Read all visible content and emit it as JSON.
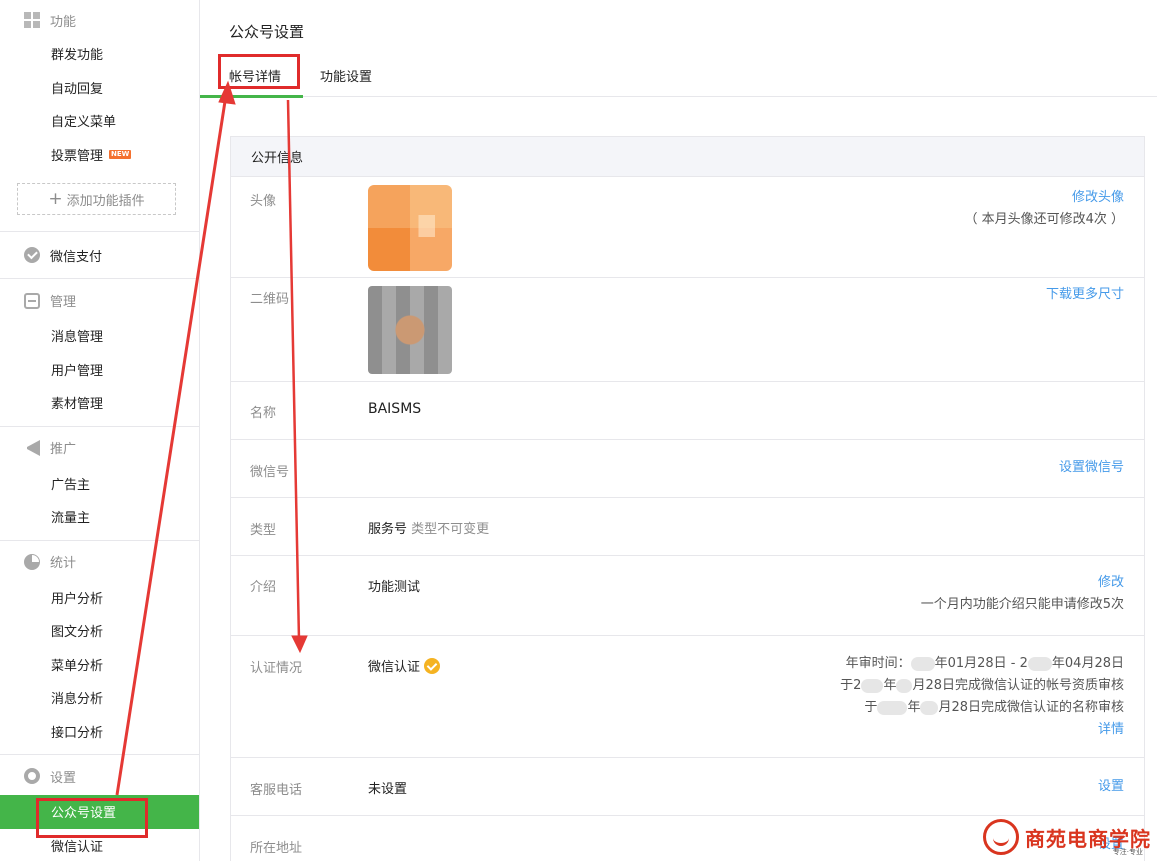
{
  "sidebar": {
    "groups": [
      {
        "title": "功能",
        "icon": "grid-icon",
        "items": [
          "群发功能",
          "自动回复",
          "自定义菜单",
          "投票管理"
        ],
        "new_badge": "NEW",
        "add_plugin": "添加功能插件"
      },
      {
        "title": "微信支付",
        "icon": "wechat-pay-icon",
        "items": []
      },
      {
        "title": "管理",
        "icon": "inbox-icon",
        "items": [
          "消息管理",
          "用户管理",
          "素材管理"
        ]
      },
      {
        "title": "推广",
        "icon": "megaphone-icon",
        "items": [
          "广告主",
          "流量主"
        ]
      },
      {
        "title": "统计",
        "icon": "pie-chart-icon",
        "items": [
          "用户分析",
          "图文分析",
          "菜单分析",
          "消息分析",
          "接口分析"
        ]
      },
      {
        "title": "设置",
        "icon": "gear-icon",
        "items": [
          "公众号设置",
          "微信认证"
        ],
        "active": "公众号设置"
      }
    ]
  },
  "main": {
    "title": "公众号设置",
    "tabs": [
      "帐号详情",
      "功能设置"
    ],
    "active_tab": "帐号详情",
    "panel": {
      "title": "公开信息",
      "avatar": {
        "label": "头像",
        "action": "修改头像",
        "note": "（ 本月头像还可修改4次 ）"
      },
      "qrcode": {
        "label": "二维码",
        "action": "下载更多尺寸"
      },
      "name": {
        "label": "名称",
        "value": "BAISMS"
      },
      "wechat_id": {
        "label": "微信号",
        "action": "设置微信号"
      },
      "type": {
        "label": "类型",
        "value": "服务号",
        "note": "类型不可变更"
      },
      "intro": {
        "label": "介绍",
        "value": "功能测试",
        "action": "修改",
        "note": "一个月内功能介绍只能申请修改5次"
      },
      "verify": {
        "label": "认证情况",
        "value": "微信认证",
        "line1_a": "年审时间：",
        "line1_b": "年01月28日 - 2",
        "line1_c": "年04月28日",
        "line2_a": "于2",
        "line2_b": "年",
        "line2_c": "月28日完成微信认证的帐号资质审核",
        "line3_a": "于",
        "line3_b": "年",
        "line3_c": "月28日完成微信认证的名称审核",
        "action": "详情"
      },
      "phone": {
        "label": "客服电话",
        "value": "未设置",
        "action": "设置"
      },
      "address": {
        "label": "所在地址",
        "action": "设置"
      }
    }
  },
  "watermark": {
    "text": "商苑电商学院",
    "sub": "专注·专业"
  },
  "colors": {
    "accent_green": "#44b549",
    "link_blue": "#459ae9",
    "annotation_red": "#e02b2b",
    "verified_badge": "#f5b322"
  }
}
